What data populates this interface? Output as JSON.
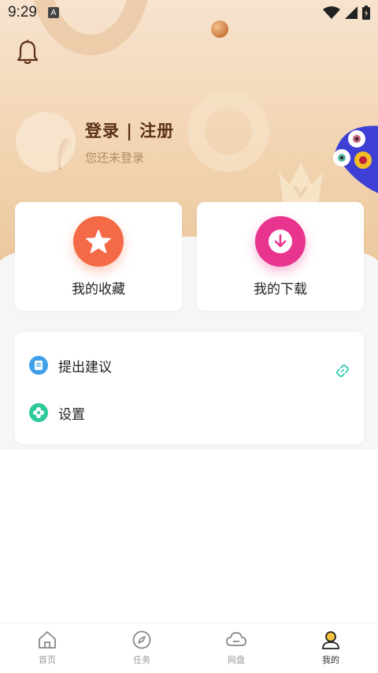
{
  "statusbar": {
    "time": "9:29",
    "app_icon_letter": "A",
    "icons": [
      "wifi-icon",
      "signal-icon",
      "battery-icon"
    ]
  },
  "profile": {
    "login_title": "登录 | 注册",
    "login_subtitle": "您还未登录"
  },
  "cards": [
    {
      "label": "我的收藏",
      "icon": "star-icon",
      "color": "#f46a46"
    },
    {
      "label": "我的下载",
      "icon": "download-icon",
      "color": "#e8348e"
    }
  ],
  "list": [
    {
      "label": "提出建议",
      "icon": "note-icon",
      "color": "#3fa0e8",
      "trailing_icon": "link-icon"
    },
    {
      "label": "设置",
      "icon": "flower-settings-icon",
      "color": "#2ec99a"
    }
  ],
  "bottom_nav": [
    {
      "label": "首页",
      "icon": "home-icon",
      "active": false
    },
    {
      "label": "任务",
      "icon": "compass-icon",
      "active": false
    },
    {
      "label": "网盘",
      "icon": "cloud-icon",
      "active": false
    },
    {
      "label": "我的",
      "icon": "user-icon",
      "active": true
    }
  ],
  "colors": {
    "accent_brown": "#5a3017",
    "hero_bg": "#f2d5b3",
    "link_teal": "#2ec9b0"
  }
}
